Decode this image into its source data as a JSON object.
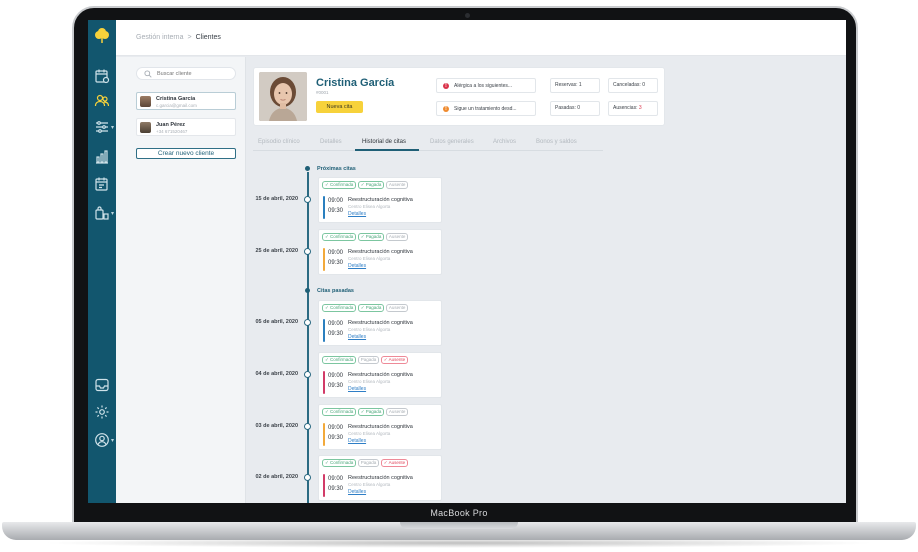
{
  "device": {
    "brand_label": "MacBook Pro"
  },
  "breadcrumb": {
    "parent": "Gestión interna",
    "separator": ">",
    "current": "Clientes"
  },
  "client_list": {
    "search_placeholder": "Buscar cliente",
    "items": [
      {
        "name": "Cristina García",
        "email": "c.garcia@gmail.com",
        "selected": true
      },
      {
        "name": "Juan Pérez",
        "phone": "+34 671520467",
        "selected": false
      }
    ],
    "new_client_label": "Crear nuevo cliente"
  },
  "profile": {
    "name": "Cristina García",
    "client_id": "#0001",
    "new_appointment_label": "Nueva cita",
    "alerts": [
      {
        "text": "Alérgica a los siguientes...",
        "color": "#d9334a",
        "icon": "exclamation-icon"
      },
      {
        "text": "Sigue un tratamiento desd...",
        "color": "#ef8a2e",
        "icon": "exclamation-icon"
      }
    ],
    "stats": {
      "reservas": {
        "label": "Reservas:",
        "value": "1"
      },
      "canceladas": {
        "label": "Canceladas:",
        "value": "0"
      },
      "pasadas": {
        "label": "Pasadas:",
        "value": "0"
      },
      "ausencias": {
        "label": "Ausencias:",
        "value": "3"
      }
    }
  },
  "tabs": [
    {
      "label": "Episodio clínico",
      "active": false
    },
    {
      "label": "Detalles",
      "active": false
    },
    {
      "label": "Historial de citas",
      "active": true
    },
    {
      "label": "Datos generales",
      "active": false
    },
    {
      "label": "Archivos",
      "active": false
    },
    {
      "label": "Bonos y saldos",
      "active": false
    }
  ],
  "timeline": {
    "upcoming_title": "Próximas citas",
    "past_title": "Citas pasadas",
    "appointments": [
      {
        "date": "15 de abril, 2020",
        "tags": [
          "✓ Confirmada",
          "✓ Pagada",
          "Ausente"
        ],
        "tag_states": [
          "ok",
          "ok",
          "grey"
        ],
        "start": "09:00",
        "end": "09:30",
        "service": "Reestructuración cognitiva",
        "center": "Centro Elisea Algorta",
        "details": "Detalles",
        "bar_color": "#2a7fbf"
      },
      {
        "date": "25 de abril, 2020",
        "tags": [
          "✓ Confirmada",
          "✓ Pagada",
          "Ausente"
        ],
        "tag_states": [
          "ok",
          "ok",
          "grey"
        ],
        "start": "09:00",
        "end": "09:30",
        "service": "Reestructuración cognitiva",
        "center": "Centro Elisea Algorta",
        "details": "Detalles",
        "bar_color": "#f2a93b"
      },
      {
        "date": "05 de abril, 2020",
        "tags": [
          "✓ Confirmada",
          "✓ Pagada",
          "Ausente"
        ],
        "tag_states": [
          "ok",
          "ok",
          "grey"
        ],
        "start": "09:00",
        "end": "09:30",
        "service": "Reestructuración cognitiva",
        "center": "Centro Elisea Algorta",
        "details": "Detalles",
        "bar_color": "#2a7fbf"
      },
      {
        "date": "04 de abril, 2020",
        "tags": [
          "✓ Confirmada",
          "Pagada",
          "✓ Ausente"
        ],
        "tag_states": [
          "ok",
          "grey",
          "bad"
        ],
        "start": "09:00",
        "end": "09:30",
        "service": "Reestructuración cognitiva",
        "center": "Centro Elisea Algorta",
        "details": "Detalles",
        "bar_color": "#d23b68"
      },
      {
        "date": "03 de abril, 2020",
        "tags": [
          "✓ Confirmada",
          "✓ Pagada",
          "Ausente"
        ],
        "tag_states": [
          "ok",
          "ok",
          "grey"
        ],
        "start": "09:00",
        "end": "09:30",
        "service": "Reestructuración cognitiva",
        "center": "Centro Elisea Algorta",
        "details": "Detalles",
        "bar_color": "#f2a93b"
      },
      {
        "date": "02 de abril, 2020",
        "tags": [
          "✓ Confirmada",
          "Pagada",
          "✓ Ausente"
        ],
        "tag_states": [
          "ok",
          "grey",
          "bad"
        ],
        "start": "09:00",
        "end": "09:30",
        "service": "Reestructuración cognitiva",
        "center": "Centro Elisea Algorta",
        "details": "Detalles",
        "bar_color": "#d23b68"
      }
    ]
  },
  "colors": {
    "sidebar": "#12566e",
    "accent": "#1f5f76",
    "button_yellow": "#f7d23b"
  }
}
